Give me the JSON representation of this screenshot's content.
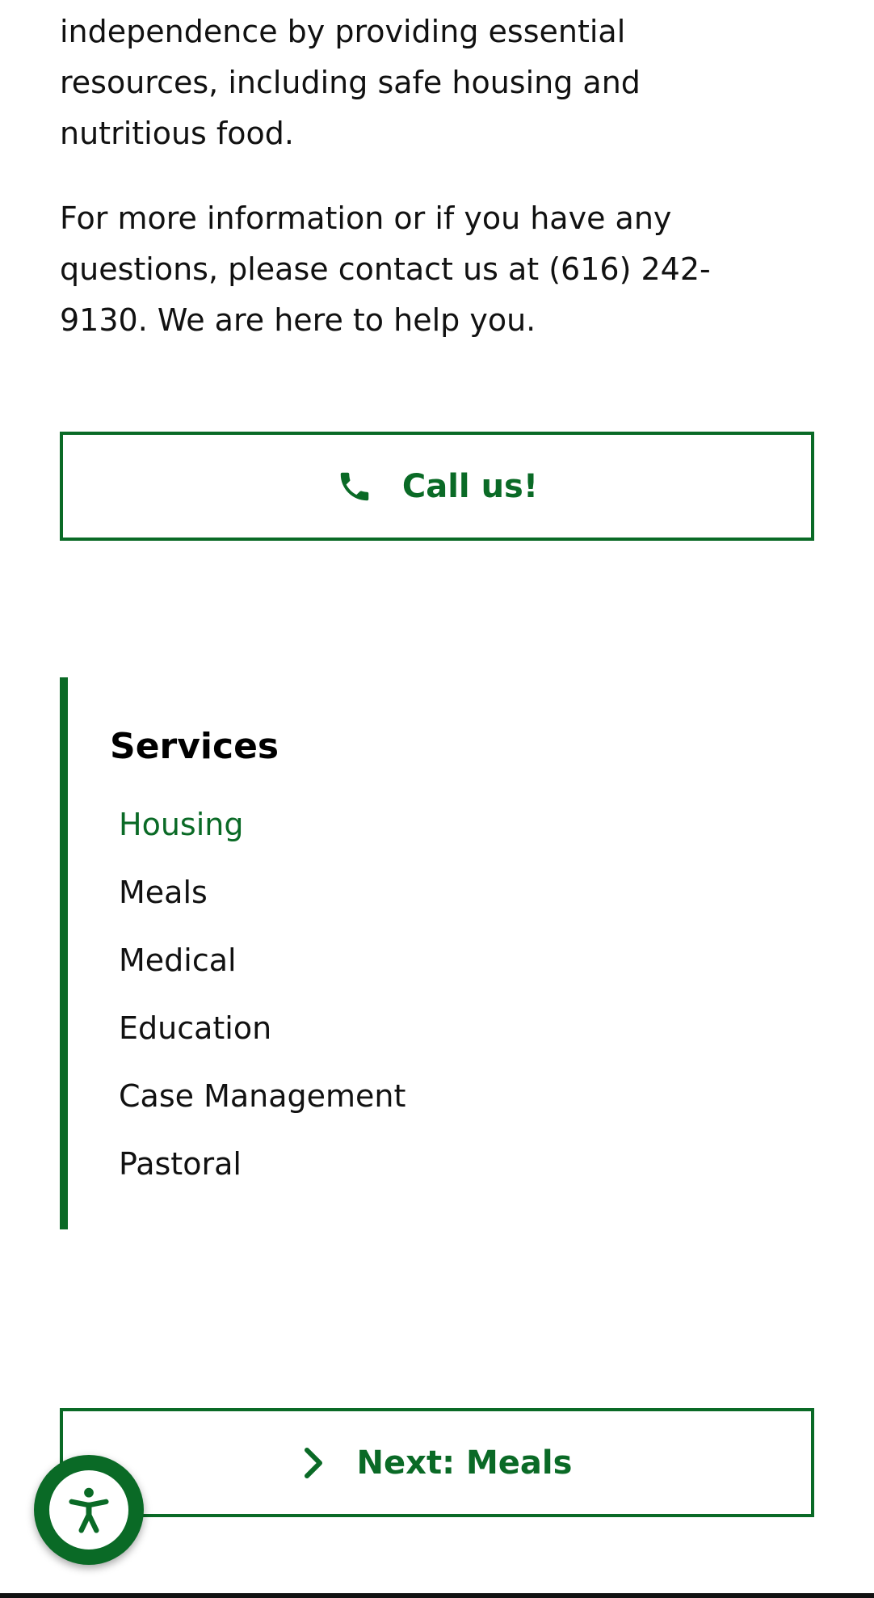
{
  "intro": {
    "paragraph1": "independence by providing essential resources, including safe housing and nutritious food.",
    "paragraph2": "For more information or if you have any questions, please contact us at (616) 242-9130. We are here to help you."
  },
  "call_button": {
    "label": "Call us!",
    "icon": "phone-icon"
  },
  "services": {
    "title": "Services",
    "items": [
      {
        "label": "Housing",
        "active": true
      },
      {
        "label": "Meals",
        "active": false
      },
      {
        "label": "Medical",
        "active": false
      },
      {
        "label": "Education",
        "active": false
      },
      {
        "label": "Case Management",
        "active": false
      },
      {
        "label": "Pastoral",
        "active": false
      }
    ]
  },
  "next_button": {
    "label": "Next: Meals",
    "icon": "chevron-right-icon"
  },
  "accessibility_button": {
    "icon": "accessibility-icon"
  },
  "colors": {
    "accent": "#0a6a26",
    "text": "#111111"
  }
}
